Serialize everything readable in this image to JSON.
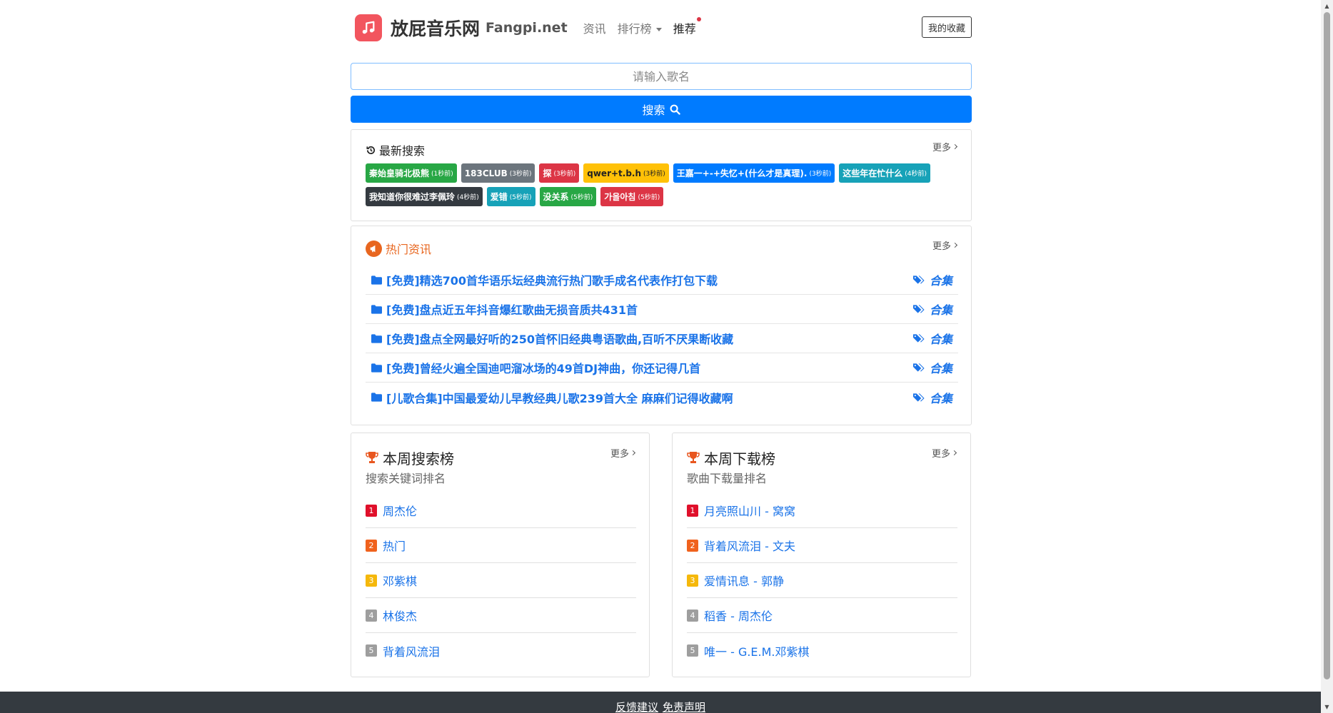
{
  "header": {
    "brand": "放屁音乐网",
    "brand_en": "Fangpi.net",
    "nav": [
      {
        "label": "资讯"
      },
      {
        "label": "排行榜"
      },
      {
        "label": "推荐"
      }
    ],
    "favorites": "我的收藏"
  },
  "search": {
    "placeholder": "请输入歌名",
    "button": "搜索"
  },
  "recent": {
    "title": "最新搜索",
    "more": "更多",
    "tags": [
      {
        "name": "秦始皇骑北极熊",
        "time": "(1秒前)",
        "color": "#28a745"
      },
      {
        "name": "183CLUB",
        "time": "(3秒前)",
        "color": "#6c757d"
      },
      {
        "name": "探",
        "time": "(3秒前)",
        "color": "#dc3545"
      },
      {
        "name": "qwer+t.b.h",
        "time": "(3秒前)",
        "color": "#ffc107"
      },
      {
        "name": "王嘉一+-+失忆+(什么才是真理).",
        "time": "(3秒前)",
        "color": "#007bff"
      },
      {
        "name": "这些年在忙什么",
        "time": "(4秒前)",
        "color": "#17a2b8"
      },
      {
        "name": "我知道你很难过李佩玲",
        "time": "(4秒前)",
        "color": "#343a40"
      },
      {
        "name": "爱错",
        "time": "(5秒前)",
        "color": "#17a2b8"
      },
      {
        "name": "没关系",
        "time": "(5秒前)",
        "color": "#28a745"
      },
      {
        "name": "가을아침",
        "time": "(5秒前)",
        "color": "#dc3545"
      }
    ]
  },
  "news": {
    "title": "热门资讯",
    "more": "更多",
    "items": [
      {
        "title": "[免费]精选700首华语乐坛经典流行热门歌手成名代表作打包下载",
        "tag": "合集"
      },
      {
        "title": "[免费]盘点近五年抖音爆红歌曲无损音质共431首",
        "tag": "合集"
      },
      {
        "title": "[免费]盘点全网最好听的250首怀旧经典粤语歌曲,百听不厌果断收藏",
        "tag": "合集"
      },
      {
        "title": "[免费]曾经火遍全国迪吧溜冰场的49首DJ神曲，你还记得几首",
        "tag": "合集"
      },
      {
        "title": "[儿歌合集]中国最爱幼儿早教经典儿歌239首大全 麻麻们记得收藏啊",
        "tag": "合集"
      }
    ]
  },
  "rank_search": {
    "title": "本周搜索榜",
    "subtitle": "搜索关键词排名",
    "more": "更多",
    "items": [
      "周杰伦",
      "热门",
      "邓紫棋",
      "林俊杰",
      "背着风流泪"
    ]
  },
  "rank_download": {
    "title": "本周下载榜",
    "subtitle": "歌曲下载量排名",
    "more": "更多",
    "items": [
      "月亮照山川 - 窝窝",
      "背着风流泪 - 文夫",
      "爱情讯息 - 郭静",
      "稻香 - 周杰伦",
      "唯一 - G.E.M.邓紫棋"
    ]
  },
  "rank_colors": [
    "#e0102b",
    "#f0621d",
    "#f5b80b",
    "#9e9e9e",
    "#9e9e9e"
  ],
  "rank_numbers": [
    "1",
    "2",
    "3",
    "4",
    "5"
  ],
  "footer": {
    "feedback": "反馈建议",
    "disclaimer": "免责声明"
  },
  "colors": {
    "primary": "#007bff",
    "link": "#1a73e8",
    "news_title": "#e8661f",
    "logo": "#f2555e",
    "footer": "#343a40"
  }
}
